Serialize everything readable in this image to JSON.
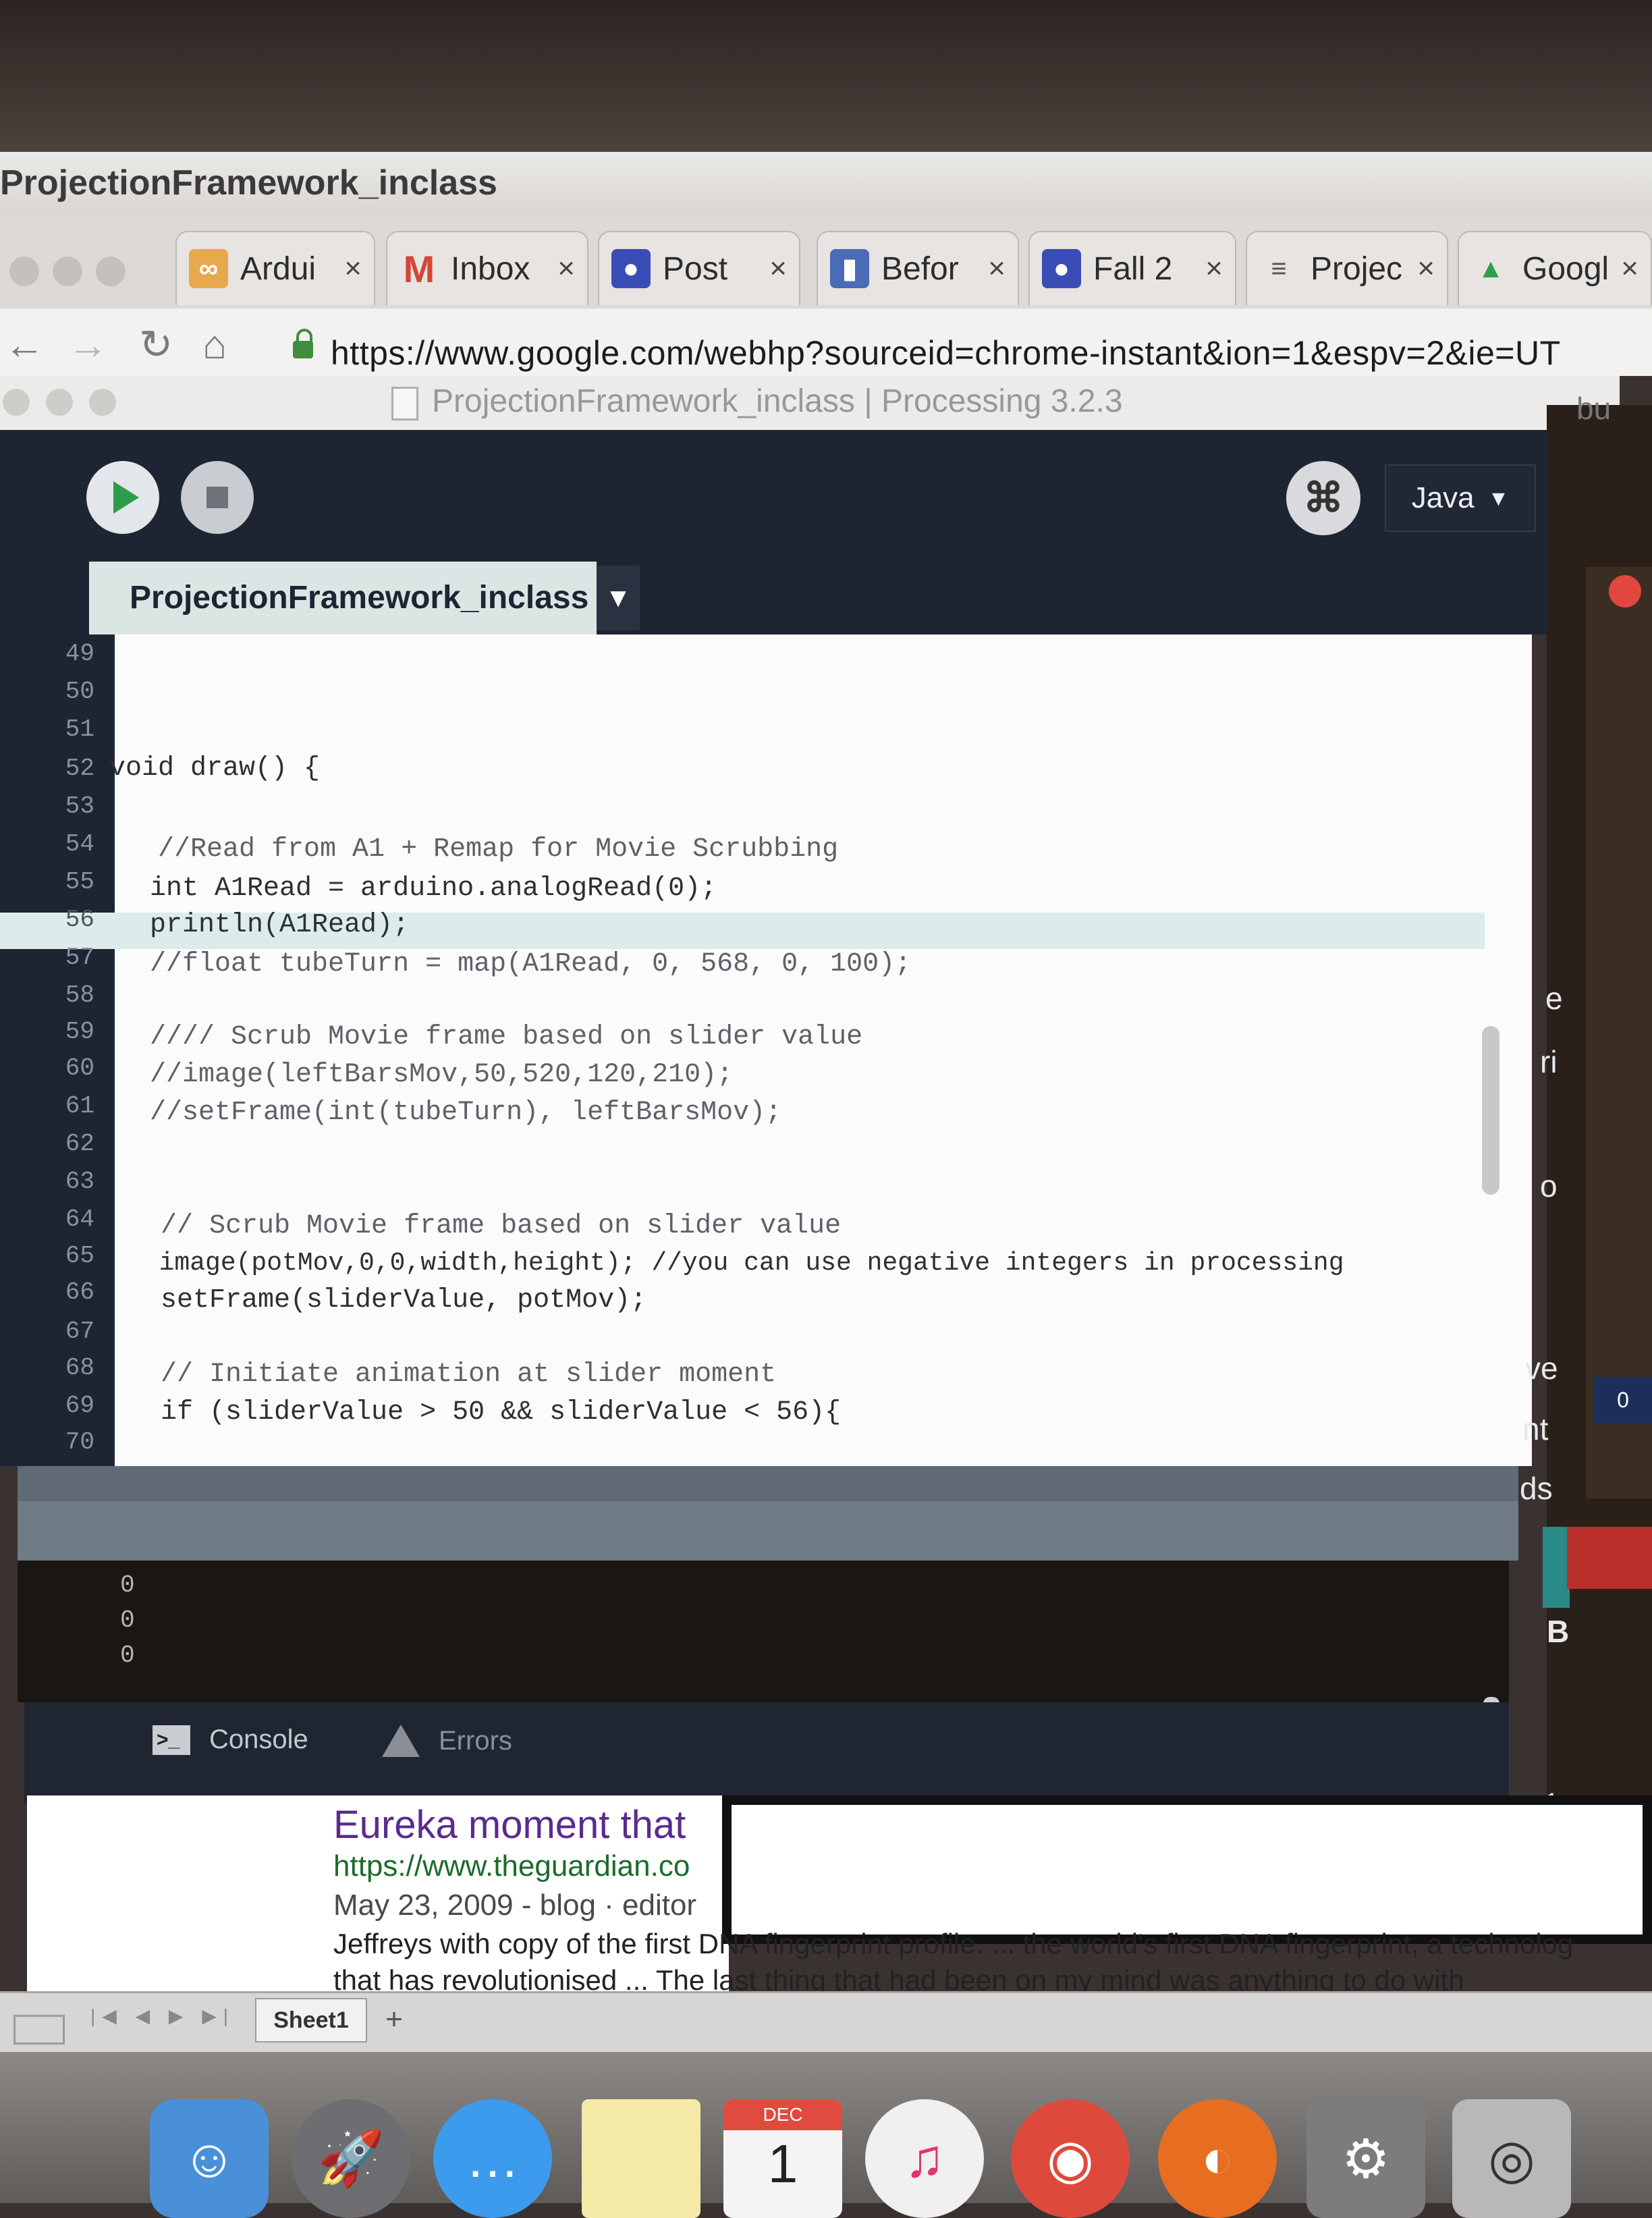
{
  "window_title": "ProjectionFramework_inclass",
  "browser": {
    "tabs": [
      {
        "label": "Ardui",
        "icon": "arduino-icon",
        "color": "#e8a84c"
      },
      {
        "label": "Inbox",
        "icon": "gmail-icon",
        "color": "#d44638"
      },
      {
        "label": "Post",
        "icon": "contacts-icon",
        "color": "#3a4db7"
      },
      {
        "label": "Befor",
        "icon": "document-icon",
        "color": "#4a6bb5"
      },
      {
        "label": "Fall 2",
        "icon": "contacts-icon",
        "color": "#3a4db7"
      },
      {
        "label": "Projec",
        "icon": "list-icon",
        "color": "#555555"
      },
      {
        "label": "Googl",
        "icon": "drive-icon",
        "color": "#2f9e4a"
      }
    ],
    "close_glyph": "×",
    "url": "https://www.google.com/webhp?sourceid=chrome-instant&ion=1&espv=2&ie=UT"
  },
  "processing": {
    "title": "ProjectionFramework_inclass | Processing 3.2.3",
    "mode_label": "Java",
    "mode_arrow": "▼",
    "debug_glyph": "⌘",
    "sketch_tab": "ProjectionFramework_inclass",
    "tab_menu_glyph": "▼",
    "lines": [
      {
        "n": "49",
        "code": ""
      },
      {
        "n": "50",
        "code": ""
      },
      {
        "n": "51",
        "code": ""
      },
      {
        "n": "52",
        "code": "void draw() {"
      },
      {
        "n": "53",
        "code": ""
      },
      {
        "n": "54",
        "code": "   //Read from A1 + Remap for Movie Scrubbing"
      },
      {
        "n": "55",
        "code": " int A1Read = arduino.analogRead(0);"
      },
      {
        "n": "56",
        "code": " println(A1Read);"
      },
      {
        "n": "57",
        "code": " //float tubeTurn = map(A1Read, 0, 568, 0, 100);"
      },
      {
        "n": "58",
        "code": ""
      },
      {
        "n": "59",
        "code": " //// Scrub Movie frame based on slider value"
      },
      {
        "n": "60",
        "code": " //image(leftBarsMov,50,520,120,210);"
      },
      {
        "n": "61",
        "code": " //setFrame(int(tubeTurn), leftBarsMov);"
      },
      {
        "n": "62",
        "code": ""
      },
      {
        "n": "63",
        "code": ""
      },
      {
        "n": "64",
        "code": "  // Scrub Movie frame based on slider value"
      },
      {
        "n": "65",
        "code": "  image(potMov,0,0,width,height); //you can use negative integers in processing"
      },
      {
        "n": "66",
        "code": "  setFrame(sliderValue, potMov);"
      },
      {
        "n": "67",
        "code": ""
      },
      {
        "n": "68",
        "code": "  // Initiate animation at slider moment"
      },
      {
        "n": "69",
        "code": "  if (sliderValue > 50 && sliderValue < 56){"
      },
      {
        "n": "70",
        "code": ""
      }
    ],
    "console_output": [
      "0",
      "0",
      "0"
    ],
    "console_tab": "Console",
    "errors_tab": "Errors",
    "console_glyph": ">_"
  },
  "right_fragments": {
    "e": "e",
    "ri": "ri",
    "o": "o",
    "ve": "ve",
    "nt": "nt",
    "ds": "ds",
    "zero": "0",
    "B": "B",
    "one": "1",
    "bu": "bu"
  },
  "search_result": {
    "title": "Eureka moment that",
    "url": "https://www.theguardian.co",
    "meta": "May 23, 2009 - blog · editor",
    "snippet1": "Jeffreys with copy of the first DNA fingerprint profile. ... the world's first DNA fingerprint, a technolog",
    "snippet2": "that has revolutionised ... The last thing that had been on my mind was anything to do with"
  },
  "spreadsheet": {
    "sheet_tab": "Sheet1",
    "add_glyph": "+",
    "nav_glyphs": "|◀ ◀ ▶ ▶|"
  },
  "dock": {
    "calendar_month": "DEC",
    "calendar_day": "1"
  }
}
